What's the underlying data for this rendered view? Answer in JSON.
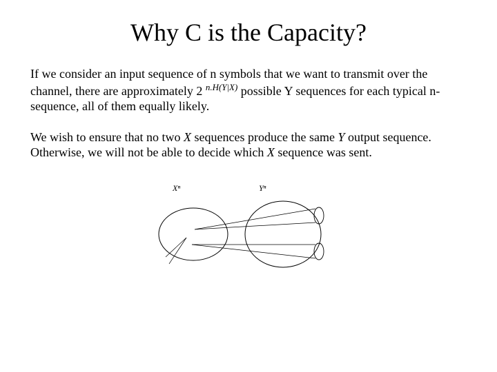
{
  "title": "Why C is the Capacity?",
  "para1_a": "If we consider an input sequence of n symbols that we want to transmit over the channel, there are approximately 2 ",
  "para1_exp": "n.H(Y|X)",
  "para1_b": " possible Y sequences for each typical n-sequence, all of them equally likely.",
  "para2_a": "We wish to ensure that no two ",
  "para2_X1": "X",
  "para2_b": " sequences produce the same ",
  "para2_Y": "Y",
  "para2_c": " output sequence. Otherwise, we will not be able to decide which ",
  "para2_X2": "X",
  "para2_d": " sequence was sent.",
  "diagram": {
    "left_label": "Xⁿ",
    "right_label": "Yⁿ"
  }
}
